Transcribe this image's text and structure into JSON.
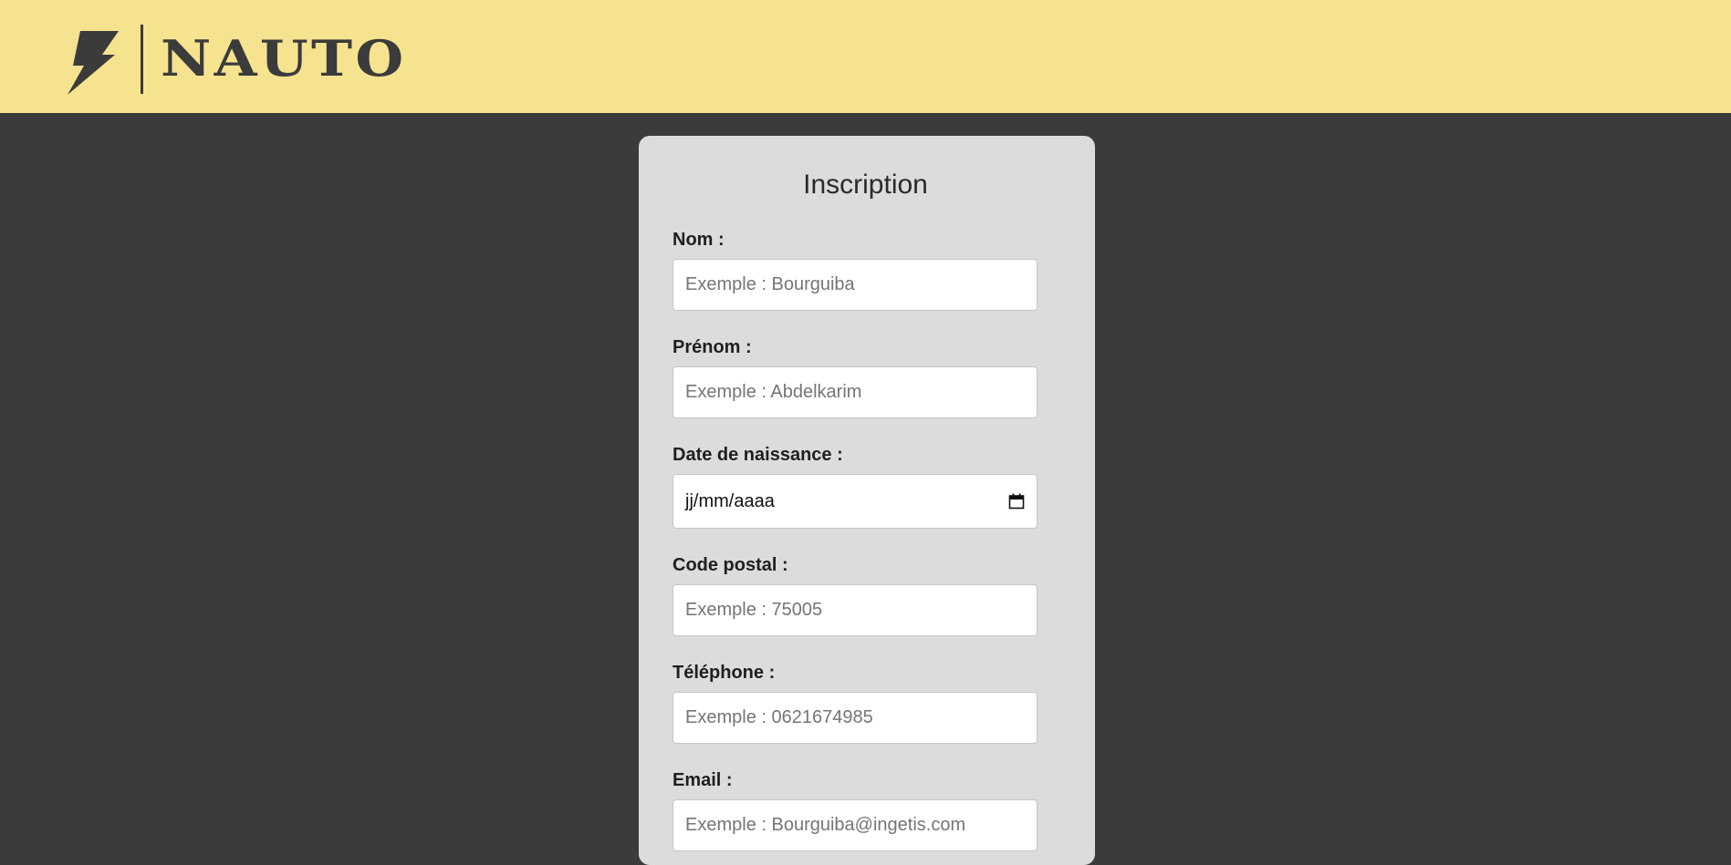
{
  "header": {
    "brand": "NAUTO",
    "bg_color": "#f6e38f"
  },
  "form": {
    "title": "Inscription",
    "fields": {
      "nom": {
        "label": "Nom :",
        "placeholder": "Exemple : Bourguiba"
      },
      "prenom": {
        "label": "Prénom :",
        "placeholder": "Exemple : Abdelkarim"
      },
      "date": {
        "label": "Date de naissance :",
        "value": "jj/mm/aaaa",
        "icon": "calendar-icon"
      },
      "code_postal": {
        "label": "Code postal :",
        "placeholder": "Exemple : 75005"
      },
      "telephone": {
        "label": "Téléphone :",
        "placeholder": "Exemple : 0621674985"
      },
      "email": {
        "label": "Email :",
        "placeholder": "Exemple : Bourguiba@ingetis.com"
      }
    }
  },
  "colors": {
    "page_bg": "#3b3b3b",
    "card_bg": "#dcdcdc"
  }
}
